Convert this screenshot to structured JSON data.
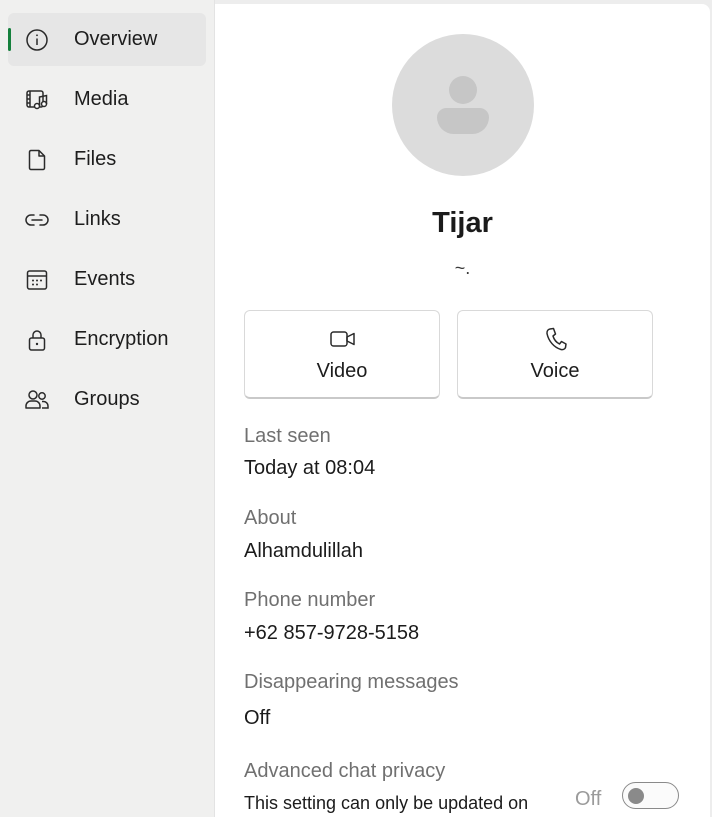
{
  "sidebar": {
    "items": [
      {
        "label": "Overview",
        "icon": "info-icon",
        "active": true
      },
      {
        "label": "Media",
        "icon": "media-icon",
        "active": false
      },
      {
        "label": "Files",
        "icon": "file-icon",
        "active": false
      },
      {
        "label": "Links",
        "icon": "link-icon",
        "active": false
      },
      {
        "label": "Events",
        "icon": "calendar-icon",
        "active": false
      },
      {
        "label": "Encryption",
        "icon": "lock-icon",
        "active": false
      },
      {
        "label": "Groups",
        "icon": "groups-icon",
        "active": false
      }
    ]
  },
  "profile": {
    "name": "Tijar",
    "status": "~."
  },
  "actions": {
    "video_label": "Video",
    "voice_label": "Voice"
  },
  "info": {
    "last_seen_label": "Last seen",
    "last_seen_value": "Today at 08:04",
    "about_label": "About",
    "about_value": "Alhamdulillah",
    "phone_label": "Phone number",
    "phone_value": "+62 857-9728-5158",
    "disappearing_label": "Disappearing messages",
    "disappearing_value": "Off",
    "privacy_label": "Advanced chat privacy",
    "privacy_desc": "This setting can only be updated on",
    "privacy_toggle_label": "Off",
    "privacy_enabled": false
  },
  "colors": {
    "active_indicator": "#15803d",
    "sidebar_bg": "#f0f0ef",
    "main_bg": "#ffffff"
  }
}
